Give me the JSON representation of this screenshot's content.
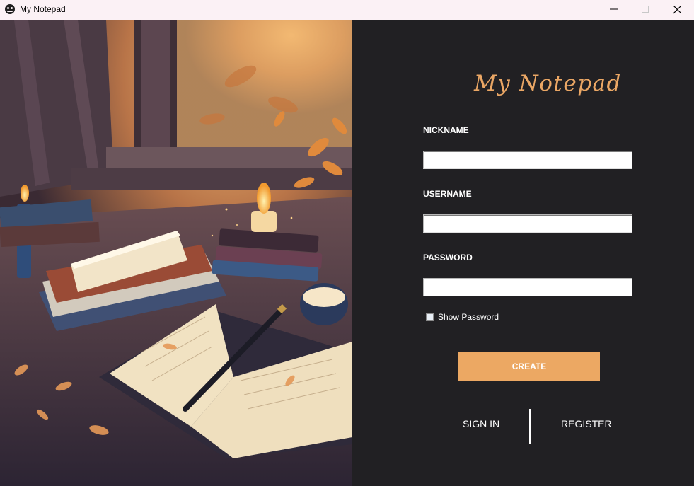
{
  "window": {
    "title": "My Notepad",
    "icon": "app-face-icon",
    "controls": [
      "minimize-icon",
      "maximize-icon",
      "close-icon"
    ]
  },
  "illustration": {
    "subject": "cozy desk with candles, books and open notebook by a window",
    "icon": "illustration-image"
  },
  "form": {
    "brand": "My Notepad",
    "nickname_label": "NICKNAME",
    "nickname_value": "",
    "username_label": "USERNAME",
    "username_value": "",
    "password_label": "PASSWORD",
    "password_value": "",
    "show_password_label": "Show Password",
    "show_password_checked": false,
    "create_label": "CREATE",
    "sign_in_label": "SIGN IN",
    "register_label": "REGISTER"
  },
  "colors": {
    "panel_bg": "#212023",
    "accent": "#eca863",
    "titlebar_bg": "#fbf1f5"
  }
}
